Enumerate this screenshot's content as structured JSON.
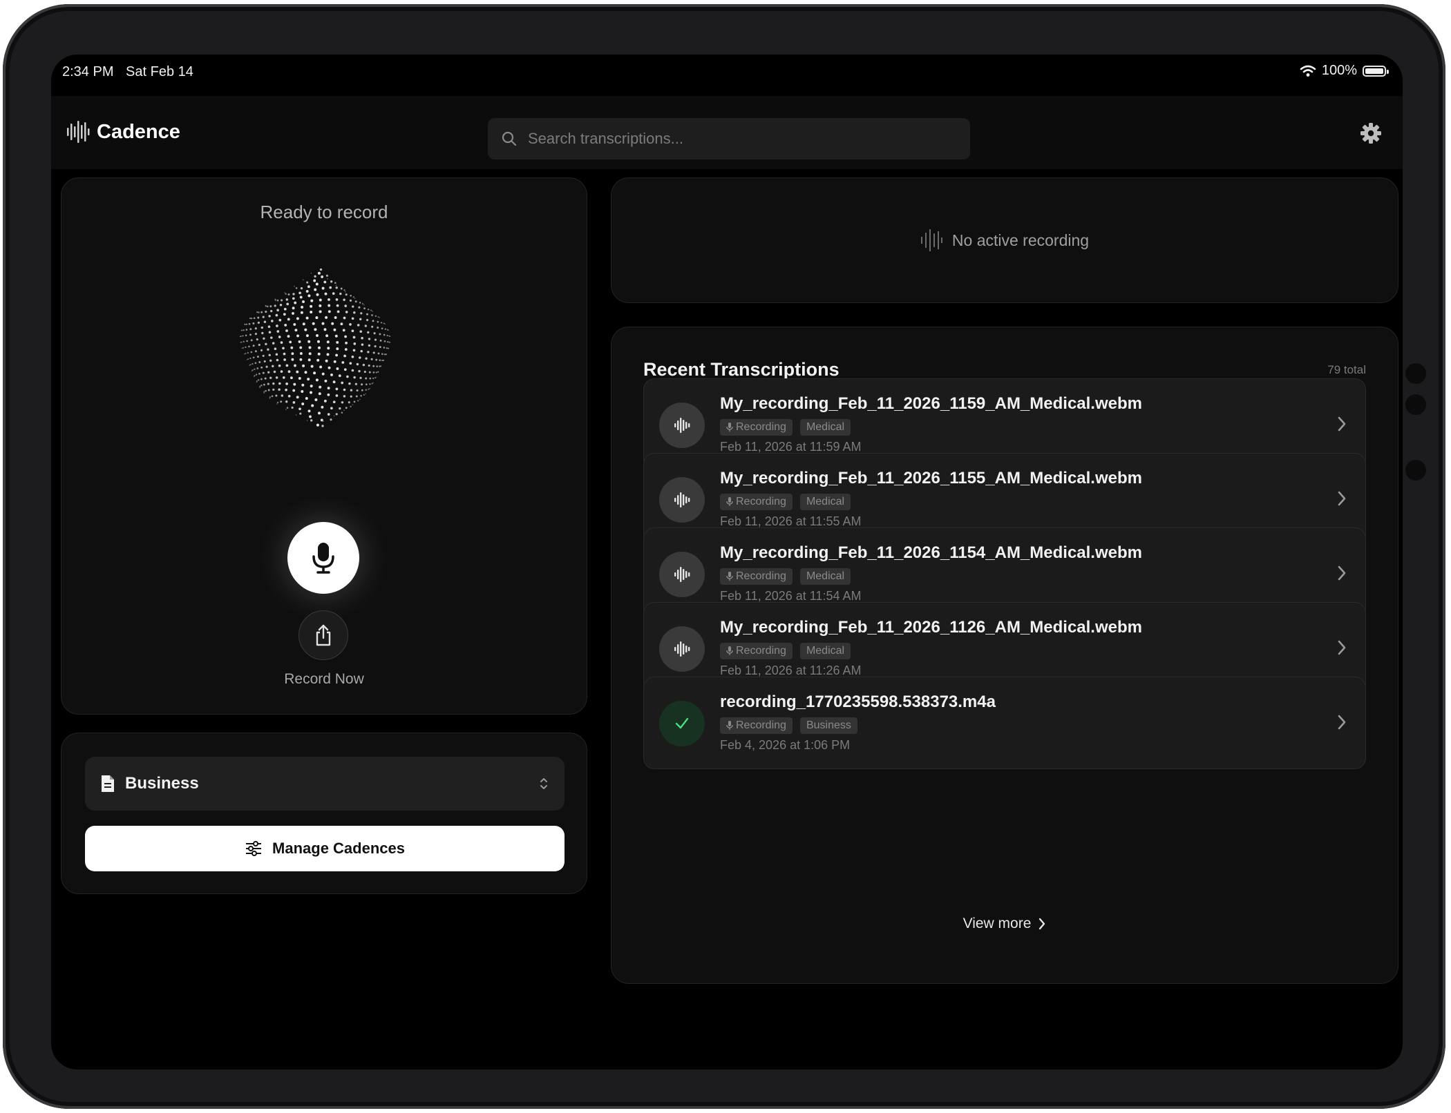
{
  "status_bar": {
    "time": "2:34 PM",
    "date": "Sat Feb 14",
    "battery": "100%"
  },
  "header": {
    "app_title": "Cadence",
    "search_placeholder": "Search transcriptions...",
    "icons": {
      "logo": "waveform-logo-icon",
      "search": "search-icon",
      "settings": "gear-icon"
    }
  },
  "recorder": {
    "status": "Ready to record",
    "action_label": "Record Now",
    "icons": {
      "record": "microphone-icon",
      "upload": "share-upload-icon"
    }
  },
  "cadence": {
    "selected": "Business",
    "manage_label": "Manage Cadences",
    "icons": {
      "doc": "document-icon",
      "select": "chevron-updown-icon",
      "manage": "sliders-icon"
    }
  },
  "active_recording": {
    "message": "No active recording"
  },
  "recent": {
    "title": "Recent Transcriptions",
    "total": "79 total",
    "items": [
      {
        "title": "My_recording_Feb_11_2026_1159_AM_Medical.webm",
        "source": "Recording",
        "category": "Medical",
        "date": "Feb 11, 2026 at 11:59 AM",
        "status": "waveform"
      },
      {
        "title": "My_recording_Feb_11_2026_1155_AM_Medical.webm",
        "source": "Recording",
        "category": "Medical",
        "date": "Feb 11, 2026 at 11:55 AM",
        "status": "waveform"
      },
      {
        "title": "My_recording_Feb_11_2026_1154_AM_Medical.webm",
        "source": "Recording",
        "category": "Medical",
        "date": "Feb 11, 2026 at 11:54 AM",
        "status": "waveform"
      },
      {
        "title": "My_recording_Feb_11_2026_1126_AM_Medical.webm",
        "source": "Recording",
        "category": "Medical",
        "date": "Feb 11, 2026 at 11:26 AM",
        "status": "waveform"
      },
      {
        "title": "recording_1770235598.538373.m4a",
        "source": "Recording",
        "category": "Business",
        "date": "Feb 4, 2026 at 1:06 PM",
        "status": "completed"
      }
    ],
    "view_more_label": "View more"
  },
  "colors": {
    "background": "#000000",
    "panel": "#0f0f0f",
    "row": "#1b1b1b",
    "completed": "#22c55e"
  }
}
